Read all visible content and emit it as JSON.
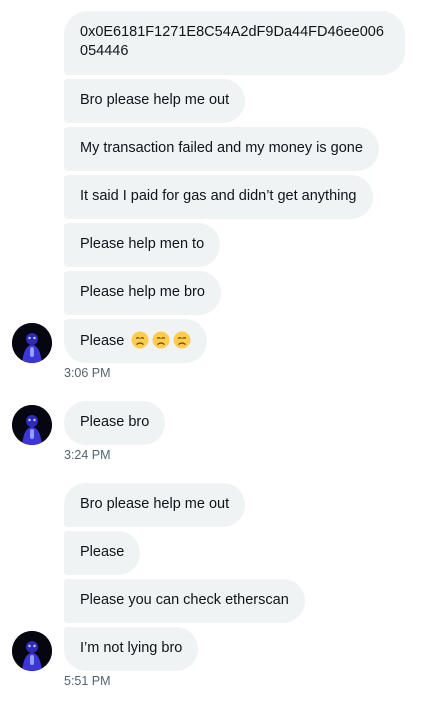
{
  "icons": {
    "avatar": "user-avatar-icon",
    "emoji": "disappointed-face-emoji"
  },
  "colors": {
    "bubble": "#eff3f4",
    "timestamp": "#536471",
    "avatar_accent": "#3b36d6"
  },
  "messages": [
    {
      "text": "0x0E6181F1271E8C54A2dF9Da44FD46ee006054446"
    },
    {
      "text": "Bro please help me out"
    },
    {
      "text": "My transaction failed and my money is gone"
    },
    {
      "text": "It said I paid for gas and didn’t get anything"
    },
    {
      "text": "Please help men to"
    },
    {
      "text": "Please help me bro"
    },
    {
      "text": "Please",
      "emoji_count": 3
    },
    {
      "text": "Please bro"
    },
    {
      "text": "Bro please help me out"
    },
    {
      "text": "Please"
    },
    {
      "text": "Please you can check etherscan"
    },
    {
      "text": "I’m not lying bro"
    }
  ],
  "timestamps": [
    "3:06 PM",
    "3:24 PM",
    "5:51 PM"
  ]
}
